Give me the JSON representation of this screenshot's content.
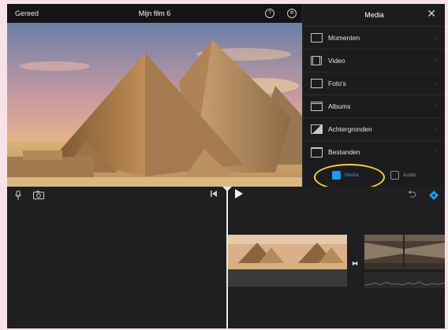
{
  "topbar": {
    "done_label": "Gereed",
    "title": "Mijn film 6",
    "help_icon": "question-circle-icon",
    "settings_icon": "gear-icon"
  },
  "panel": {
    "title": "Media",
    "close_icon": "close-icon",
    "items": [
      {
        "label": "Momenten",
        "icon": "moments-icon"
      },
      {
        "label": "Video",
        "icon": "film-icon"
      },
      {
        "label": "Foto's",
        "icon": "photo-icon"
      },
      {
        "label": "Albums",
        "icon": "album-icon"
      },
      {
        "label": "Achtergronden",
        "icon": "backgrounds-icon"
      },
      {
        "label": "Bestanden",
        "icon": "folder-icon"
      }
    ],
    "tabs": [
      {
        "label": "Media",
        "icon": "media-tab-icon",
        "active": true
      },
      {
        "label": "Audio",
        "icon": "audio-tab-icon",
        "active": false
      }
    ]
  },
  "toolbar": {
    "mic_icon": "microphone-icon",
    "camera_icon": "camera-icon",
    "skip_back_icon": "skip-to-start-icon",
    "play_icon": "play-icon",
    "undo_icon": "undo-icon",
    "settings_icon": "project-settings-icon"
  },
  "colors": {
    "accent": "#1e9bf0",
    "highlight": "#f3d33b",
    "background": "#1f1f21"
  }
}
